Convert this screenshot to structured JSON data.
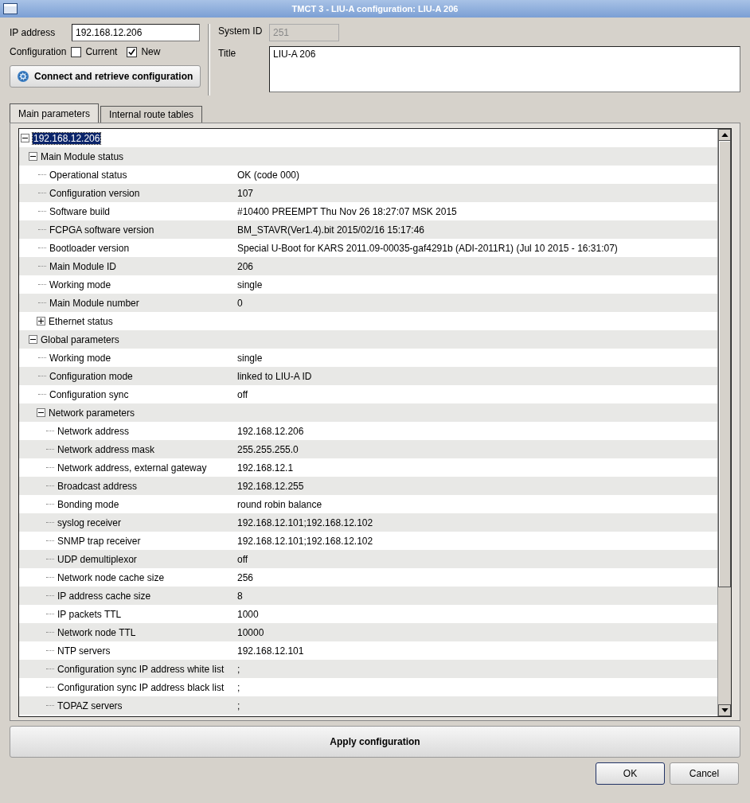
{
  "window": {
    "title": "TMCT 3 - LIU-A configuration: LIU-A 206"
  },
  "ip_address": {
    "label": "IP address",
    "value": "192.168.12.206"
  },
  "configuration": {
    "label": "Configuration",
    "options": [
      {
        "label": "Current",
        "checked": false
      },
      {
        "label": "New",
        "checked": true
      }
    ]
  },
  "connect_button": "Connect and retrieve configuration",
  "system_id": {
    "label": "System ID",
    "value": "251",
    "disabled": true
  },
  "title_field": {
    "label": "Title",
    "value": "LIU-A 206"
  },
  "tabs": [
    {
      "label": "Main parameters",
      "selected": true
    },
    {
      "label": "Internal route tables",
      "selected": false
    }
  ],
  "tree": [
    {
      "label": "192.168.12.206",
      "selected": true,
      "expanded": true,
      "children": [
        {
          "label": "Main Module status",
          "expanded": true,
          "children": [
            {
              "label": "Operational status",
              "value": "OK (code 000)"
            },
            {
              "label": "Configuration version",
              "value": "107"
            },
            {
              "label": "Software build",
              "value": "#10400 PREEMPT Thu Nov 26 18:27:07 MSK 2015"
            },
            {
              "label": "FCPGA software version",
              "value": "BM_STAVR(Ver1.4).bit 2015/02/16 15:17:46"
            },
            {
              "label": "Bootloader version",
              "value": "Special U-Boot for KARS 2011.09-00035-gaf4291b (ADI-2011R1) (Jul 10 2015 - 16:31:07)"
            },
            {
              "label": "Main Module ID",
              "value": "206"
            },
            {
              "label": "Working mode",
              "value": "single"
            },
            {
              "label": "Main Module number",
              "value": "0"
            },
            {
              "label": "Ethernet status",
              "expanded": false
            }
          ]
        },
        {
          "label": "Global parameters",
          "expanded": true,
          "children": [
            {
              "label": "Working mode",
              "value": "single"
            },
            {
              "label": "Configuration mode",
              "value": "linked to LIU-A ID"
            },
            {
              "label": "Configuration sync",
              "value": "off"
            },
            {
              "label": "Network parameters",
              "expanded": true,
              "children": [
                {
                  "label": "Network address",
                  "value": "192.168.12.206"
                },
                {
                  "label": "Network address mask",
                  "value": "255.255.255.0"
                },
                {
                  "label": "Network address, external gateway",
                  "value": "192.168.12.1"
                },
                {
                  "label": "Broadcast address",
                  "value": "192.168.12.255"
                },
                {
                  "label": "Bonding mode",
                  "value": "round robin balance"
                },
                {
                  "label": "syslog receiver",
                  "value": "192.168.12.101;192.168.12.102"
                },
                {
                  "label": "SNMP trap receiver",
                  "value": "192.168.12.101;192.168.12.102"
                },
                {
                  "label": "UDP demultiplexor",
                  "value": "off"
                },
                {
                  "label": "Network node cache size",
                  "value": "256"
                },
                {
                  "label": "IP address cache size",
                  "value": "8"
                },
                {
                  "label": "IP packets TTL",
                  "value": "1000"
                },
                {
                  "label": "Network node TTL",
                  "value": "10000"
                },
                {
                  "label": "NTP servers",
                  "value": "192.168.12.101"
                },
                {
                  "label": "Configuration sync IP address white list",
                  "value": ";"
                },
                {
                  "label": "Configuration sync IP address black list",
                  "value": ";"
                },
                {
                  "label": "TOPAZ servers",
                  "value": ";"
                }
              ]
            }
          ]
        }
      ]
    }
  ],
  "apply_button": "Apply configuration",
  "buttons": [
    "OK",
    "Cancel"
  ]
}
